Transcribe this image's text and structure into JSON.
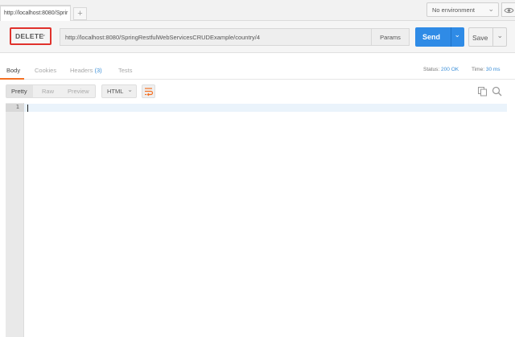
{
  "tabs": [
    {
      "label": "http://localhost:8080/Sprir"
    }
  ],
  "new_tab_label": "+",
  "environment": {
    "selected": "No environment"
  },
  "request": {
    "method": "DELETE",
    "url": "http://localhost:8080/SpringRestfulWebServicesCRUDExample/country/4",
    "params_label": "Params",
    "send_label": "Send",
    "save_label": "Save"
  },
  "response": {
    "tabs": {
      "body": "Body",
      "cookies": "Cookies",
      "headers": "Headers",
      "headers_count": "(3)",
      "tests": "Tests"
    },
    "status_label": "Status:",
    "status_value": "200 OK",
    "time_label": "Time:",
    "time_value": "30 ms",
    "modes": {
      "pretty": "Pretty",
      "raw": "Raw",
      "preview": "Preview"
    },
    "format": "HTML",
    "lines": [
      "1"
    ]
  },
  "colors": {
    "accent": "#f47023",
    "send": "#2f8be6",
    "highlight": "#e0322c",
    "link": "#3c8fd8"
  }
}
